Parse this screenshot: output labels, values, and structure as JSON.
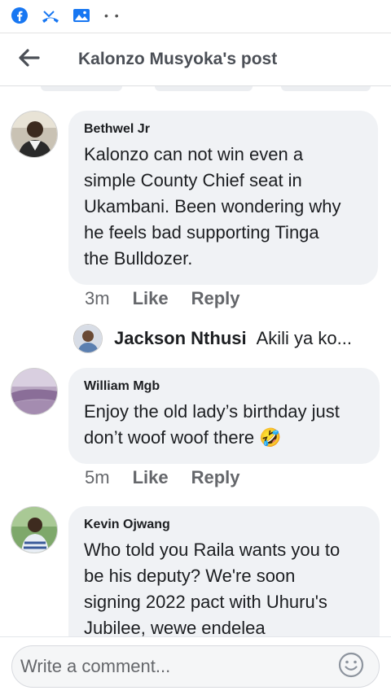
{
  "status_bar": {
    "icons": [
      "facebook-icon",
      "missed-call-icon",
      "gallery-icon"
    ],
    "more": "• •"
  },
  "header": {
    "title": "Kalonzo Musyoka's post"
  },
  "comments": [
    {
      "author": "Bethwel Jr",
      "lines": [
        "Kalonzo can not win even a",
        "simple County Chief seat in",
        "Ukambani. Been wondering why",
        "he feels bad supporting Tinga",
        "the Bulldozer."
      ],
      "time": "3m",
      "like": "Like",
      "reply": "Reply"
    },
    {
      "author": "William Mgb",
      "lines": [
        "Enjoy the old lady’s birthday just",
        "don’t  woof woof there"
      ],
      "emoji": "🤣",
      "time": "5m",
      "like": "Like",
      "reply": "Reply"
    },
    {
      "author": "Kevin Ojwang",
      "lines": [
        "Who told you Raila wants you to",
        "be his deputy? We're soon",
        "signing 2022 pact with Uhuru's",
        "Jubilee, wewe endelea"
      ]
    }
  ],
  "reply_preview": {
    "name": "Jackson Nthusi",
    "text": "Akili ya ko..."
  },
  "composer": {
    "placeholder": "Write a comment..."
  },
  "colors": {
    "bubble": "#f0f2f5",
    "facebook_blue": "#1877f2",
    "secondary_text": "#65676b"
  }
}
